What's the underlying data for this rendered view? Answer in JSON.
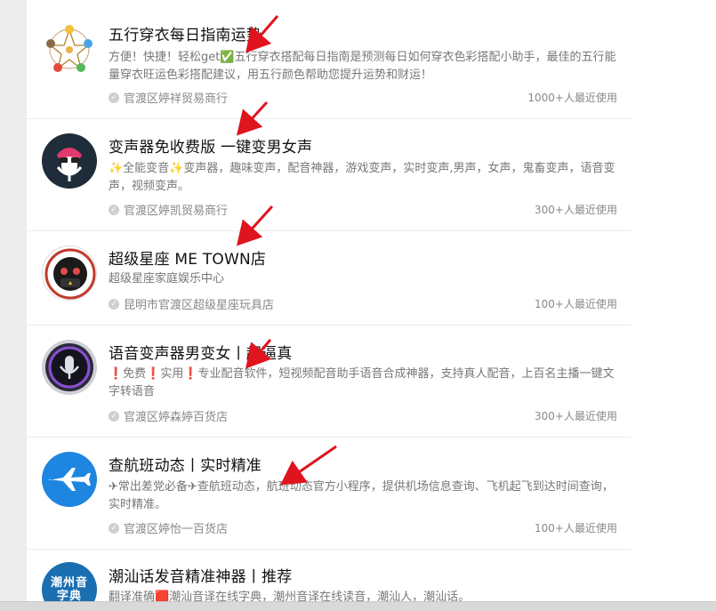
{
  "items": [
    {
      "title": "五行穿衣每日指南运势",
      "desc": "方便！快捷！轻松get✅五行穿衣搭配每日指南是预测每日如何穿衣色彩搭配小助手，最佳的五行能量穿衣旺运色彩搭配建议，用五行颜色帮助您提升运势和财运！",
      "owner": "官渡区婷祥贸易商行",
      "users": "1000+人最近使用",
      "icon": "wuxing-star-icon"
    },
    {
      "title": "变声器免收费版 一键变男女声",
      "desc": "✨全能变音✨变声器，趣味变声，配音神器，游戏变声，实时变声,男声，女声，鬼畜变声，语音变声，视频变声。",
      "owner": "官渡区婷凯贸易商行",
      "users": "300+人最近使用",
      "icon": "voice-changer-mic-icon"
    },
    {
      "title": "超级星座 ME TOWN店",
      "desc": "超级星座家庭娱乐中心",
      "owner": "昆明市官渡区超级星座玩具店",
      "users": "100+人最近使用",
      "icon": "super-constellation-badge-icon"
    },
    {
      "title": "语音变声器男变女丨超逼真",
      "desc": "❗免费❗实用❗专业配音软件，短视频配音助手语音合成神器，支持真人配音，上百名主播一键文字转语音",
      "owner": "官渡区婷森婷百货店",
      "users": "300+人最近使用",
      "icon": "siri-mic-icon"
    },
    {
      "title": "查航班动态丨实时精准",
      "desc": "✈常出差党必备✈查航班动态，航班动态官方小程序，提供机场信息查询、飞机起飞到达时间查询，实时精准。",
      "owner": "官渡区婷怡一百货店",
      "users": "100+人最近使用",
      "icon": "airplane-icon"
    },
    {
      "title": "潮汕话发音精准神器丨推荐",
      "desc": "翻译准确🟥潮汕音译在线字典，潮州音译在线读音，潮汕人，潮汕话。",
      "owner": "",
      "users": "",
      "icon": "chaozhou-dictionary-icon",
      "logo_text": "潮州音字典"
    }
  ],
  "verified_icon": "verified-check-icon",
  "colors": {
    "arrow": "#e0141e",
    "airplane_bg": "#1e86e0",
    "chaozhou_bg": "#1a6fb0",
    "voice_bg": "#1f2d3a",
    "mic_accent": "#e0306a",
    "siri_purple": "#8a4fd0"
  }
}
